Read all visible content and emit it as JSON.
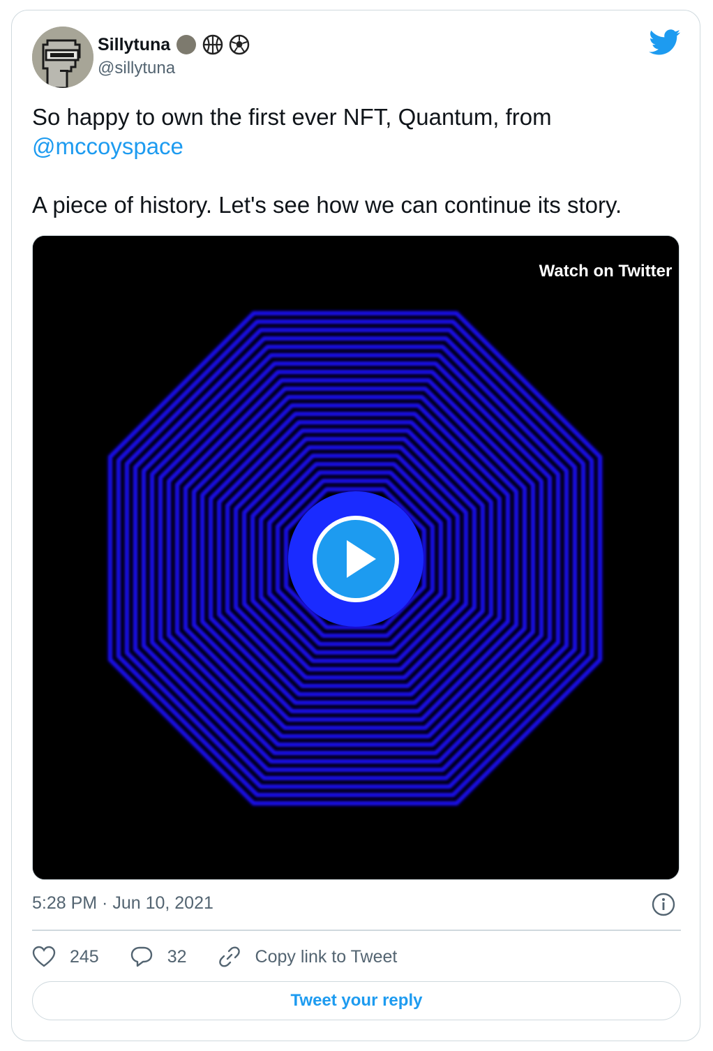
{
  "author": {
    "name": "Sillytuna",
    "handle": "@sillytuna",
    "badges": [
      "grey-circle-icon",
      "basketball-icon",
      "soccer-ball-icon"
    ]
  },
  "tweet": {
    "line1": "So happy to own the first ever NFT, Quantum, from",
    "mention": "@mccoyspace",
    "line2": "A piece of history. Let's see how we can continue its story."
  },
  "media": {
    "watch_label": "Watch on Twitter",
    "play_icon": "play-icon"
  },
  "meta": {
    "timestamp": "5:28 PM · Jun 10, 2021"
  },
  "actions": {
    "likes": "245",
    "replies": "32",
    "copy_link_label": "Copy link to Tweet"
  },
  "reply_button_label": "Tweet your reply",
  "colors": {
    "accent": "#1d9bf0",
    "muted": "#536471",
    "border": "#cfd9de",
    "octagon": "#1a10ff"
  }
}
